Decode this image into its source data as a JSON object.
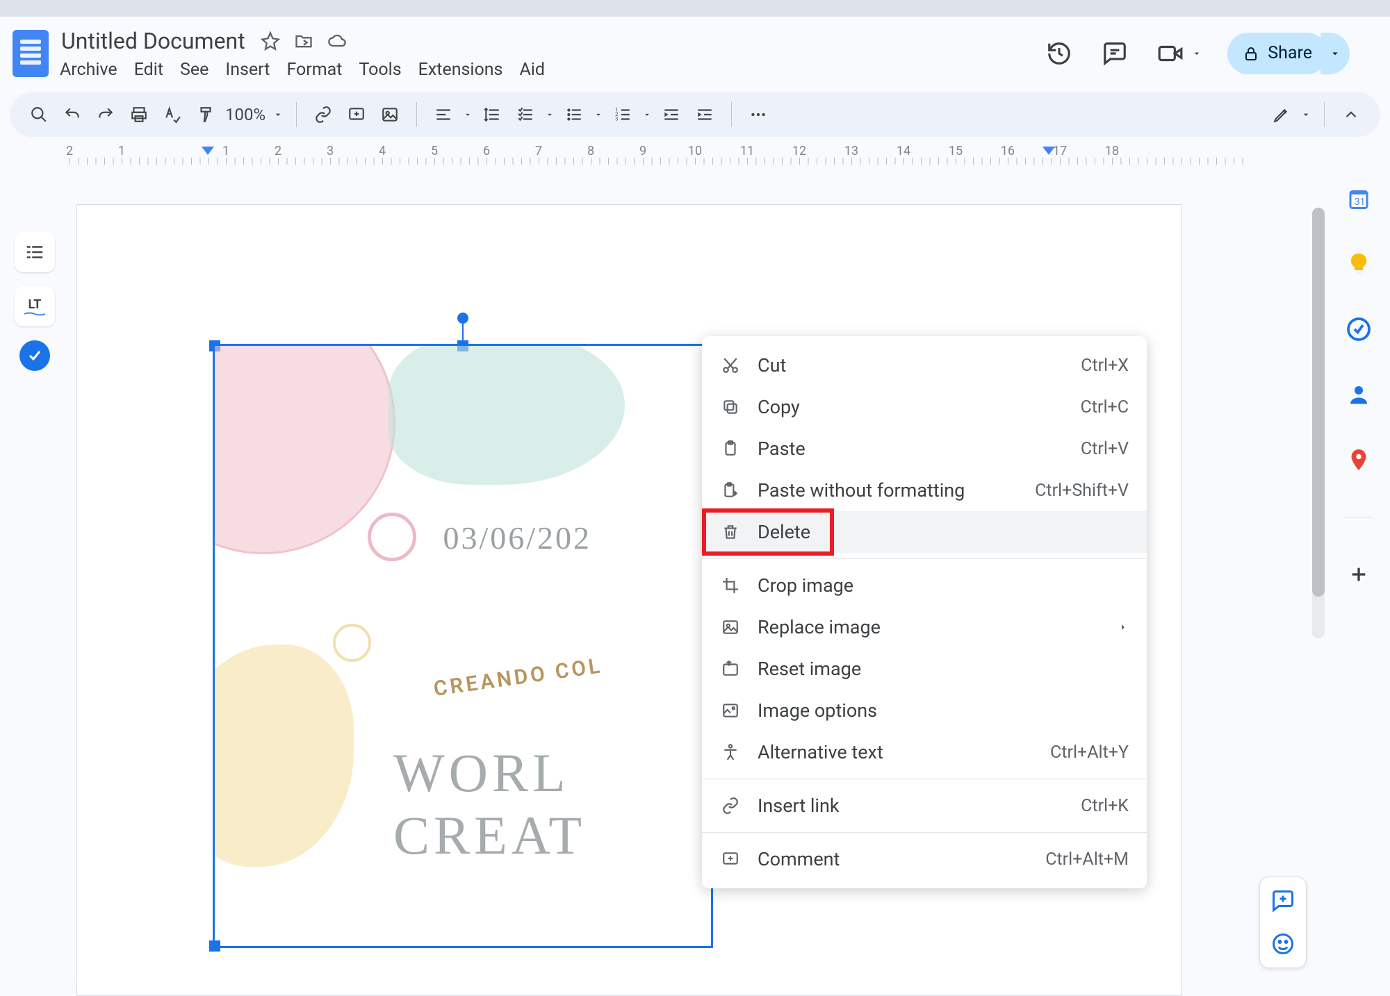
{
  "document": {
    "title": "Untitled Document"
  },
  "menus": {
    "archive": "Archive",
    "edit": "Edit",
    "see": "See",
    "insert": "Insert",
    "format": "Format",
    "tools": "Tools",
    "extensions": "Extensions",
    "aid": "Aid"
  },
  "share": {
    "label": "Share"
  },
  "toolbar": {
    "zoom": "100%"
  },
  "ruler": {
    "ticks": [
      "2",
      "1",
      "",
      "1",
      "2",
      "3",
      "4",
      "5",
      "6",
      "7",
      "8",
      "9",
      "10",
      "11",
      "12",
      "13",
      "14",
      "15",
      "16",
      "17",
      "18"
    ]
  },
  "image_content": {
    "date": "03/06/202",
    "arc": "CREANDO COL",
    "line1": "WORL",
    "line2": "CREAT"
  },
  "context_menu": {
    "items": [
      {
        "id": "cut",
        "label": "Cut",
        "shortcut": "Ctrl+X",
        "icon": "cut-icon"
      },
      {
        "id": "copy",
        "label": "Copy",
        "shortcut": "Ctrl+C",
        "icon": "copy-icon"
      },
      {
        "id": "paste",
        "label": "Paste",
        "shortcut": "Ctrl+V",
        "icon": "paste-icon"
      },
      {
        "id": "pastewf",
        "label": "Paste without formatting",
        "shortcut": "Ctrl+Shift+V",
        "icon": "paste-plain-icon"
      },
      {
        "id": "delete",
        "label": "Delete",
        "shortcut": "",
        "icon": "trash-icon",
        "highlighted": true
      },
      {
        "sep": true
      },
      {
        "id": "crop",
        "label": "Crop image",
        "shortcut": "",
        "icon": "crop-icon"
      },
      {
        "id": "replace",
        "label": "Replace image",
        "shortcut": "",
        "icon": "image-icon",
        "submenu": true
      },
      {
        "id": "reset",
        "label": "Reset image",
        "shortcut": "",
        "icon": "reset-image-icon"
      },
      {
        "id": "options",
        "label": "Image options",
        "shortcut": "",
        "icon": "image-options-icon"
      },
      {
        "id": "alt",
        "label": "Alternative text",
        "shortcut": "Ctrl+Alt+Y",
        "icon": "accessibility-icon"
      },
      {
        "sep": true
      },
      {
        "id": "link",
        "label": "Insert link",
        "shortcut": "Ctrl+K",
        "icon": "link-icon"
      },
      {
        "sep": true
      },
      {
        "id": "comment",
        "label": "Comment",
        "shortcut": "Ctrl+Alt+M",
        "icon": "comment-add-icon"
      }
    ]
  },
  "side_apps": [
    "calendar",
    "keep",
    "tasks",
    "contacts",
    "maps",
    "add"
  ]
}
